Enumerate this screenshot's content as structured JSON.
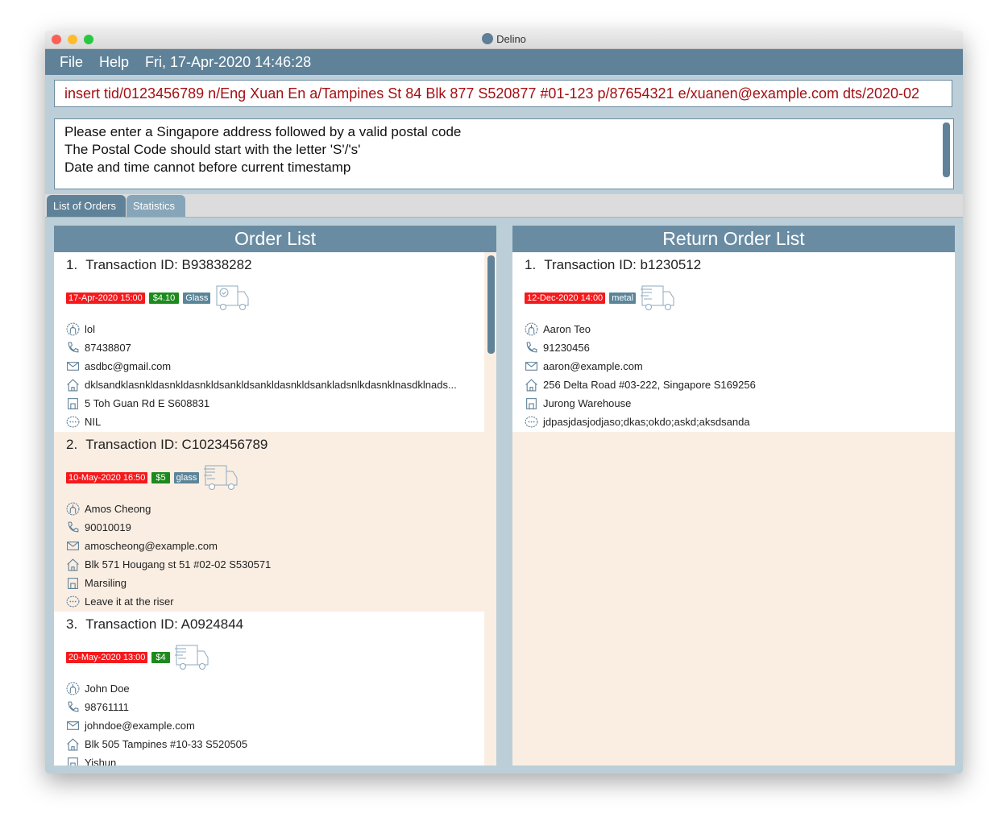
{
  "window": {
    "title": "Delino"
  },
  "menu": {
    "file": "File",
    "help": "Help",
    "datetime": "Fri, 17-Apr-2020 14:46:28"
  },
  "command": {
    "value": "insert tid/0123456789 n/Eng Xuan En a/Tampines St 84 Blk 877 S520877 #01-123 p/87654321 e/xuanen@example.com dts/2020-02"
  },
  "result": {
    "lines": [
      "Please enter a Singapore address followed by a valid postal code",
      "The Postal Code should start with the letter 'S'/'s'",
      "Date and time cannot before current timestamp"
    ]
  },
  "tabs": [
    {
      "label": "List of Orders",
      "active": true
    },
    {
      "label": "Statistics",
      "active": false
    }
  ],
  "colors": {
    "date_tag": "#f5191c",
    "cash_tag": "#1c8a1c",
    "type_tag": "#5b8599",
    "peach": "#faeee3"
  },
  "order_list": {
    "title": "Order List",
    "items": [
      {
        "index": "1.",
        "tid": "Transaction ID: B93838282",
        "date": "17-Apr-2020 15:00",
        "cash": "$4.10",
        "type": "Glass",
        "truck": "delivered-truck-icon",
        "name": "lol",
        "phone": "87438807",
        "email": "asdbc@gmail.com",
        "address": "dklsandklasnkldasnkldasnkldsankldsankldasnkldsankladsnlkdasnklnasdklnads...",
        "warehouse": "5 Toh Guan Rd E S608831",
        "comment": "NIL"
      },
      {
        "index": "2.",
        "tid": "Transaction ID: C1023456789",
        "date": "10-May-2020 16:50",
        "cash": "$5",
        "type": "glass",
        "truck": "moving-truck-icon",
        "name": "Amos Cheong",
        "phone": "90010019",
        "email": "amoscheong@example.com",
        "address": "Blk 571 Hougang st 51 #02-02 S530571",
        "warehouse": "Marsiling",
        "comment": "Leave it at the riser"
      },
      {
        "index": "3.",
        "tid": "Transaction ID: A0924844",
        "date": "20-May-2020 13:00",
        "cash": "$4",
        "truck": "moving-truck-icon",
        "name": "John Doe",
        "phone": "98761111",
        "email": "johndoe@example.com",
        "address": "Blk 505 Tampines #10-33 S520505",
        "warehouse": "Yishun"
      }
    ]
  },
  "return_list": {
    "title": "Return Order List",
    "items": [
      {
        "index": "1.",
        "tid": "Transaction ID: b1230512",
        "date": "12-Dec-2020 14:00",
        "type": "metal",
        "truck": "moving-truck-icon",
        "name": "Aaron Teo",
        "phone": "91230456",
        "email": "aaron@example.com",
        "address": "256 Delta Road #03-222, Singapore S169256",
        "warehouse": "Jurong Warehouse",
        "comment": "jdpasjdasjodjaso;dkas;okdo;askd;aksdsanda"
      }
    ]
  }
}
